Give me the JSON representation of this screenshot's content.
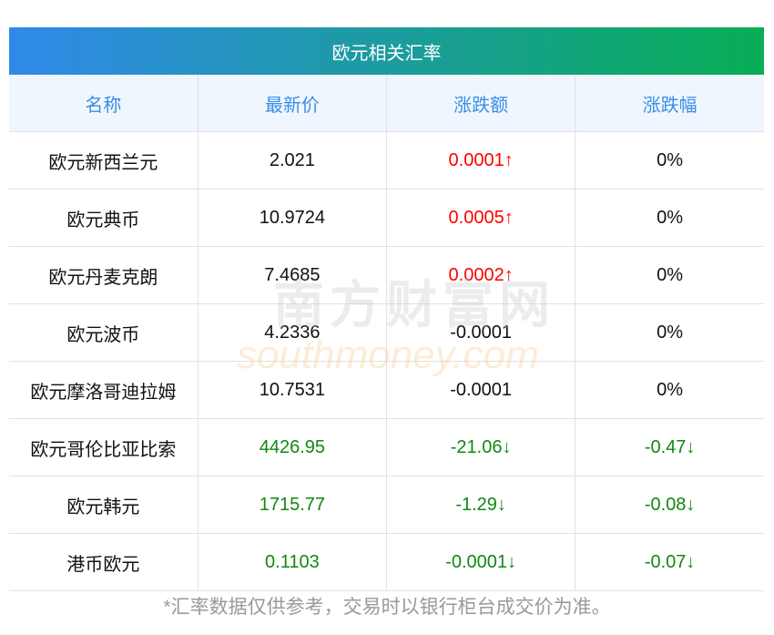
{
  "title": "欧元相关汇率",
  "columns": [
    "名称",
    "最新价",
    "涨跌额",
    "涨跌幅"
  ],
  "rows": [
    {
      "name": "欧元新西兰元",
      "price": "2.021",
      "change": "0.0001↑",
      "pct": "0%",
      "price_dir": "flat",
      "change_dir": "up",
      "pct_dir": "flat"
    },
    {
      "name": "欧元典币",
      "price": "10.9724",
      "change": "0.0005↑",
      "pct": "0%",
      "price_dir": "flat",
      "change_dir": "up",
      "pct_dir": "flat"
    },
    {
      "name": "欧元丹麦克朗",
      "price": "7.4685",
      "change": "0.0002↑",
      "pct": "0%",
      "price_dir": "flat",
      "change_dir": "up",
      "pct_dir": "flat"
    },
    {
      "name": "欧元波币",
      "price": "4.2336",
      "change": "-0.0001",
      "pct": "0%",
      "price_dir": "flat",
      "change_dir": "flat",
      "pct_dir": "flat"
    },
    {
      "name": "欧元摩洛哥迪拉姆",
      "price": "10.7531",
      "change": "-0.0001",
      "pct": "0%",
      "price_dir": "flat",
      "change_dir": "flat",
      "pct_dir": "flat"
    },
    {
      "name": "欧元哥伦比亚比索",
      "price": "4426.95",
      "change": "-21.06↓",
      "pct": "-0.47↓",
      "price_dir": "down",
      "change_dir": "down",
      "pct_dir": "down"
    },
    {
      "name": "欧元韩元",
      "price": "1715.77",
      "change": "-1.29↓",
      "pct": "-0.08↓",
      "price_dir": "down",
      "change_dir": "down",
      "pct_dir": "down"
    },
    {
      "name": "港币欧元",
      "price": "0.1103",
      "change": "-0.0001↓",
      "pct": "-0.07↓",
      "price_dir": "down",
      "change_dir": "down",
      "pct_dir": "down"
    }
  ],
  "footer": "*汇率数据仅供参考，交易时以银行柜台成交价为准。",
  "watermark": {
    "cn": "南方财富网",
    "en": "southmoney.com"
  },
  "colors": {
    "up": "#ff0000",
    "down": "#118811",
    "header_text": "#3a8ee6"
  }
}
